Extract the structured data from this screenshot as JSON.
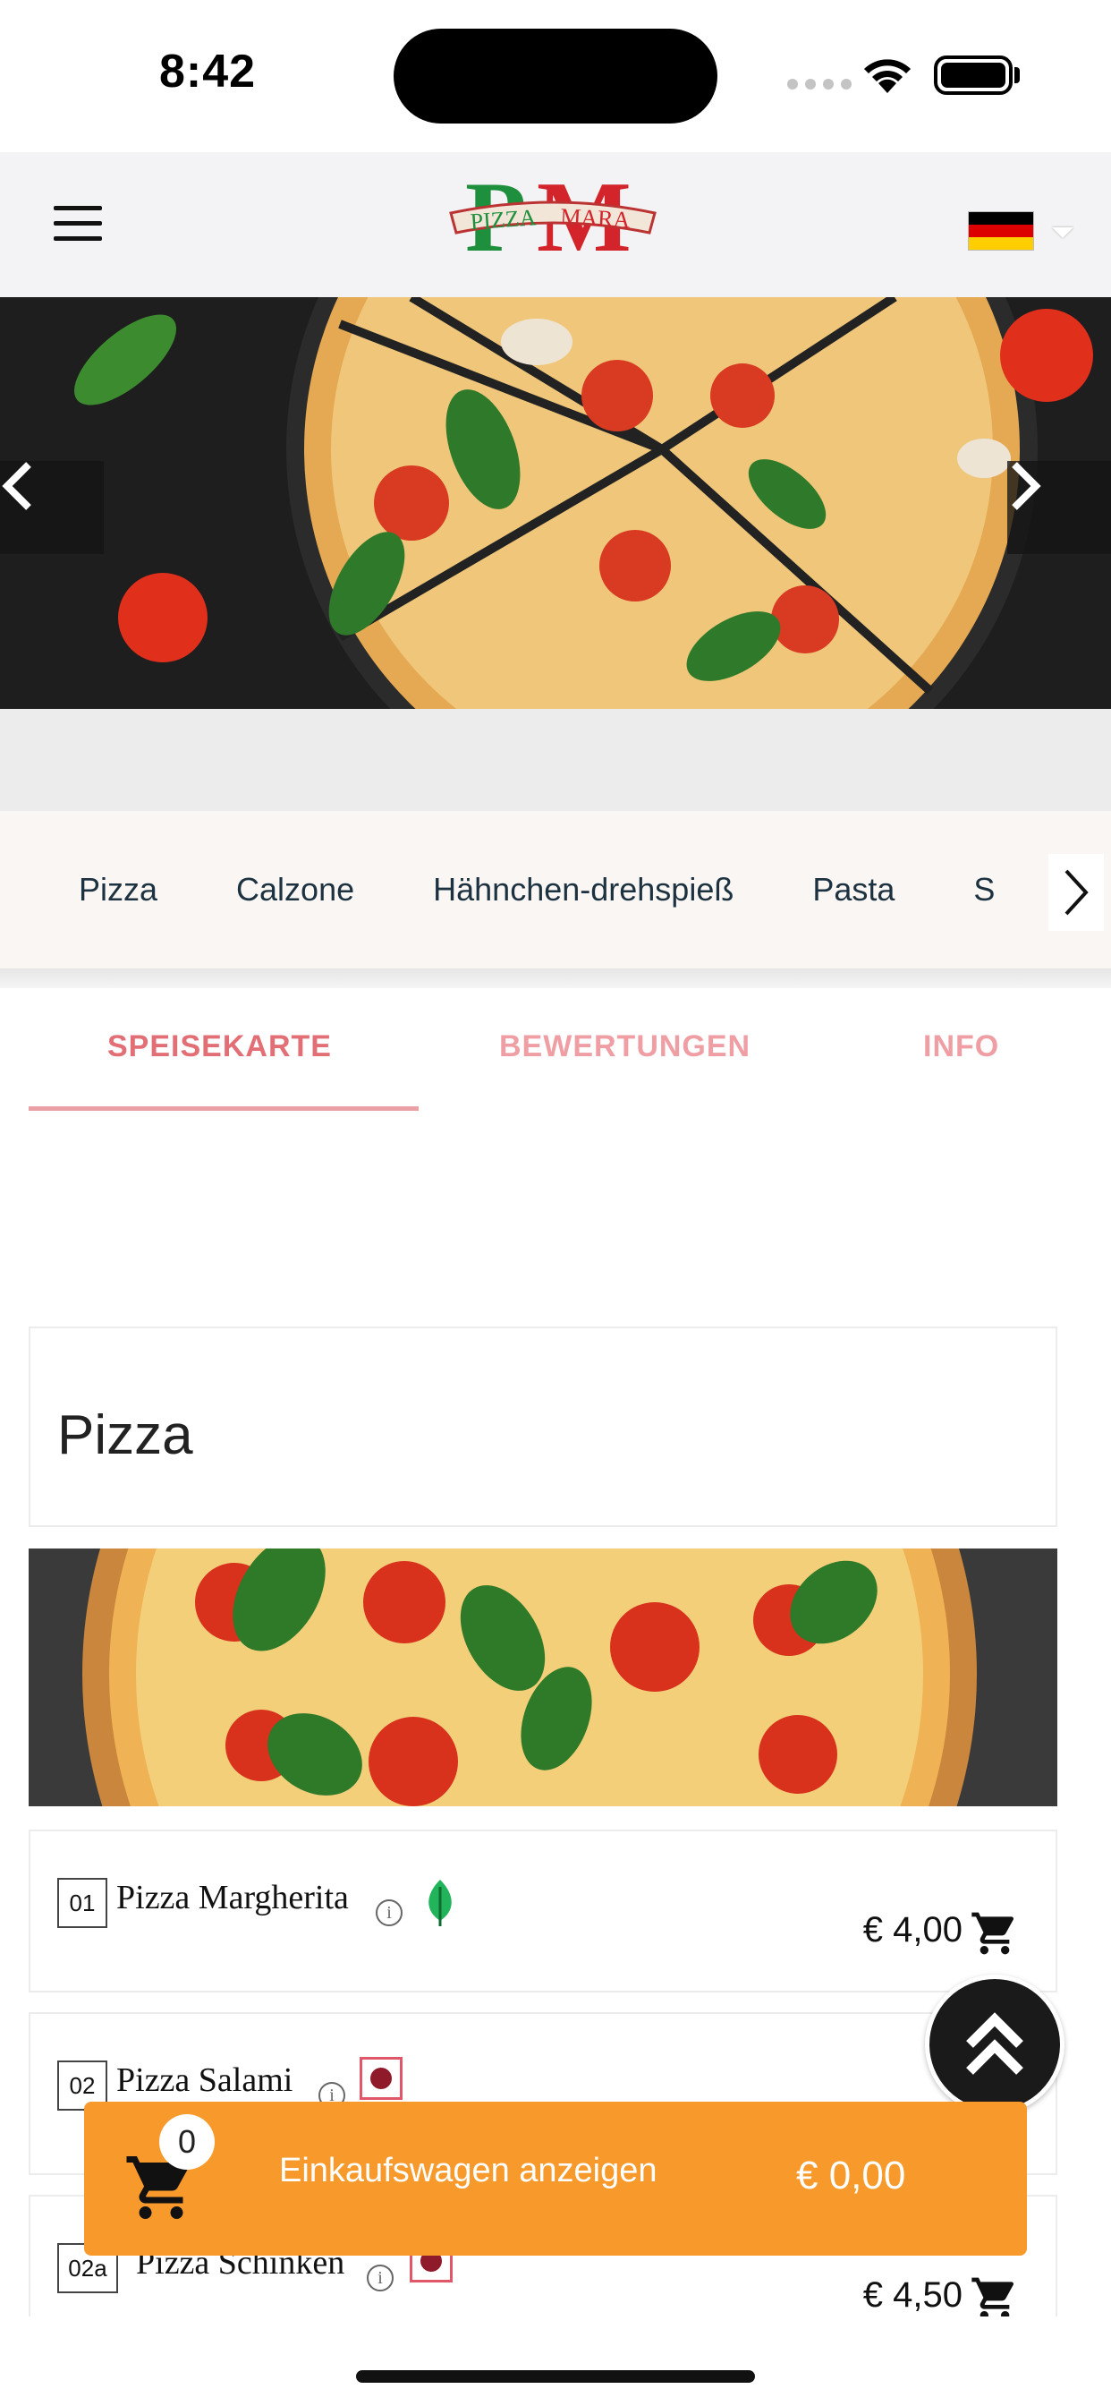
{
  "status_bar": {
    "time": "8:42"
  },
  "header": {
    "logo_text": "PIZZA MARA",
    "logo_monogram": "PM",
    "language_flag": "germany-flag-icon",
    "colors": {
      "logo_green": "#1e8f3c",
      "logo_red": "#d3232b"
    }
  },
  "categories": {
    "items": [
      {
        "label": "Pizza"
      },
      {
        "label": "Calzone"
      },
      {
        "label": "Hähnchen-drehspieß"
      },
      {
        "label": "Pasta"
      },
      {
        "label": "S"
      }
    ]
  },
  "tabs": {
    "items": [
      {
        "label": "SPEISEKARTE"
      },
      {
        "label": "BEWERTUNGEN"
      },
      {
        "label": "INFO"
      }
    ],
    "active_index": 0,
    "colors": {
      "active": "#e36f76",
      "inactive": "#ef9ea4"
    }
  },
  "section": {
    "title": "Pizza"
  },
  "menu_items": [
    {
      "number": "01",
      "name": "Pizza Margherita",
      "price": "€ 4,00",
      "badge": "vegetarian-leaf-icon"
    },
    {
      "number": "02",
      "name": "Pizza Salami",
      "price": "",
      "badge": "meat-icon"
    },
    {
      "number": "02a",
      "name": "Pizza Schinken",
      "price": "€ 4,50",
      "badge": "meat-icon"
    }
  ],
  "cart": {
    "count": "0",
    "label": "Einkaufswagen anzeigen",
    "total": "€ 0,00",
    "color": "#f79a2b"
  }
}
